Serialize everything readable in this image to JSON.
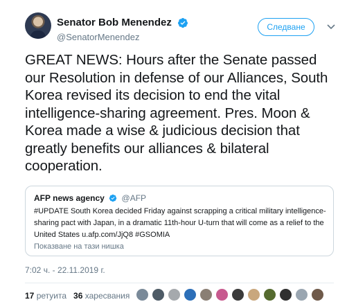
{
  "author": {
    "display_name": "Senator Bob Menendez",
    "handle": "@SenatorMenendez",
    "follow_label": "Следване"
  },
  "tweet": {
    "text": "GREAT NEWS: Hours after the Senate passed our Resolution in defense of our Alliances, South Korea revised its decision to end the vital intelligence-sharing agreement. Pres. Moon & Korea made a wise & judicious decision that greatly benefits our alliances & bilateral cooperation.",
    "timestamp": "7:02 ч. - 22.11.2019 г."
  },
  "quoted": {
    "name": "AFP news agency",
    "handle": "@AFP",
    "text": "#UPDATE South Korea decided Friday against scrapping a critical military intelligence-sharing pact with Japan, in a dramatic 11th-hour U-turn that will come as a relief to the United States u.afp.com/JjQ8 #GSOMIA",
    "show_thread": "Показване на тази нишка"
  },
  "stats": {
    "retweets_count": "17",
    "retweets_label": "ретуита",
    "likes_count": "36",
    "likes_label": "харесвания"
  },
  "likers": [
    {
      "color": "#7a8a99"
    },
    {
      "color": "#4e5b66"
    },
    {
      "color": "#a5a9ad"
    },
    {
      "color": "#2c6fb8"
    },
    {
      "color": "#8a7f74"
    },
    {
      "color": "#c85a8f"
    },
    {
      "color": "#3b3b3b"
    },
    {
      "color": "#c9a77d"
    },
    {
      "color": "#556b2f"
    },
    {
      "color": "#2f2f2f"
    },
    {
      "color": "#9aa6b1"
    },
    {
      "color": "#6f5a4a"
    }
  ],
  "colors": {
    "accent": "#1da1f2",
    "muted": "#657786",
    "border": "#ccd6dd"
  }
}
